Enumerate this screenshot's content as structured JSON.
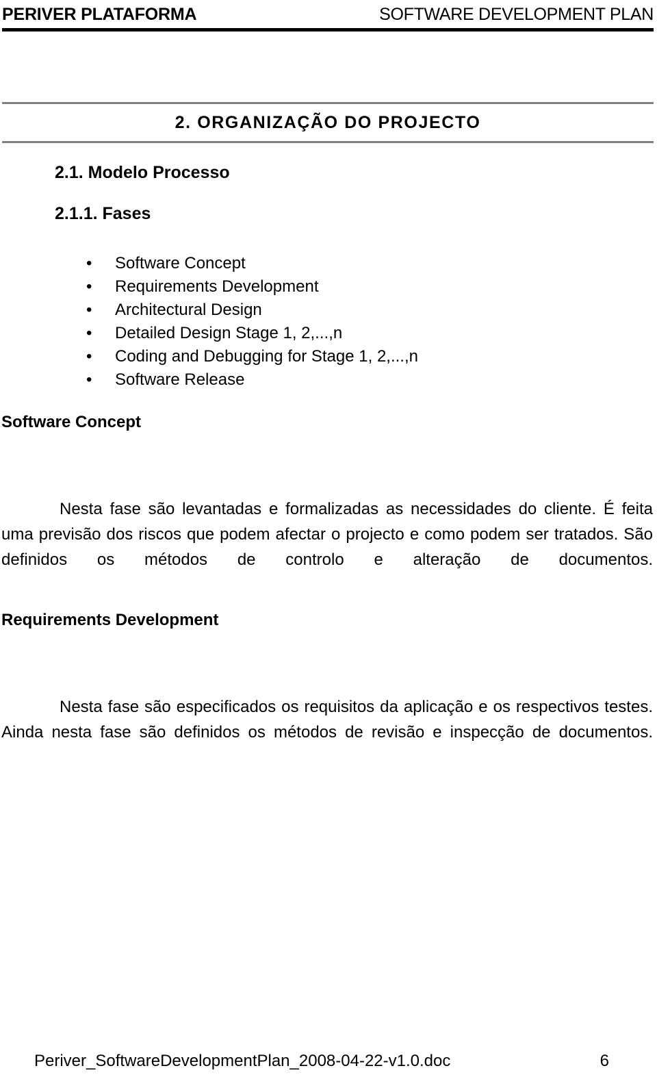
{
  "header": {
    "left_title": "PERIVER PLATAFORMA",
    "right_title": "SOFTWARE DEVELOPMENT PLAN"
  },
  "section": {
    "title": "2. ORGANIZAÇÃO DO PROJECTO"
  },
  "subheadings": {
    "modelo_processo": "2.1. Modelo Processo",
    "fases": "2.1.1. Fases"
  },
  "phase_list": {
    "bullet_glyph": "•",
    "items": [
      "Software Concept",
      "Requirements Development",
      "Architectural Design",
      "Detailed Design Stage 1, 2,...,n",
      "Coding and Debugging for Stage 1, 2,...,n",
      "Software Release"
    ]
  },
  "phases": [
    {
      "heading": "Software Concept",
      "body": "Nesta fase são levantadas e formalizadas as necessidades do cliente. É feita uma previsão dos riscos que podem afectar o projecto e como podem ser tratados. São definidos os métodos de controlo e alteração de documentos."
    },
    {
      "heading": "Requirements Development",
      "body": "Nesta fase são especificados os requisitos da aplicação e os respectivos testes. Ainda nesta fase são definidos os métodos de revisão e inspecção de documentos."
    }
  ],
  "footer": {
    "file_name": "Periver_SoftwareDevelopmentPlan_2008-04-22-v1.0.doc",
    "page_number": "6"
  },
  "colors": {
    "text": "#000000",
    "header_rule": "#000000",
    "section_rule": "#808080",
    "page_background": "#ffffff"
  }
}
